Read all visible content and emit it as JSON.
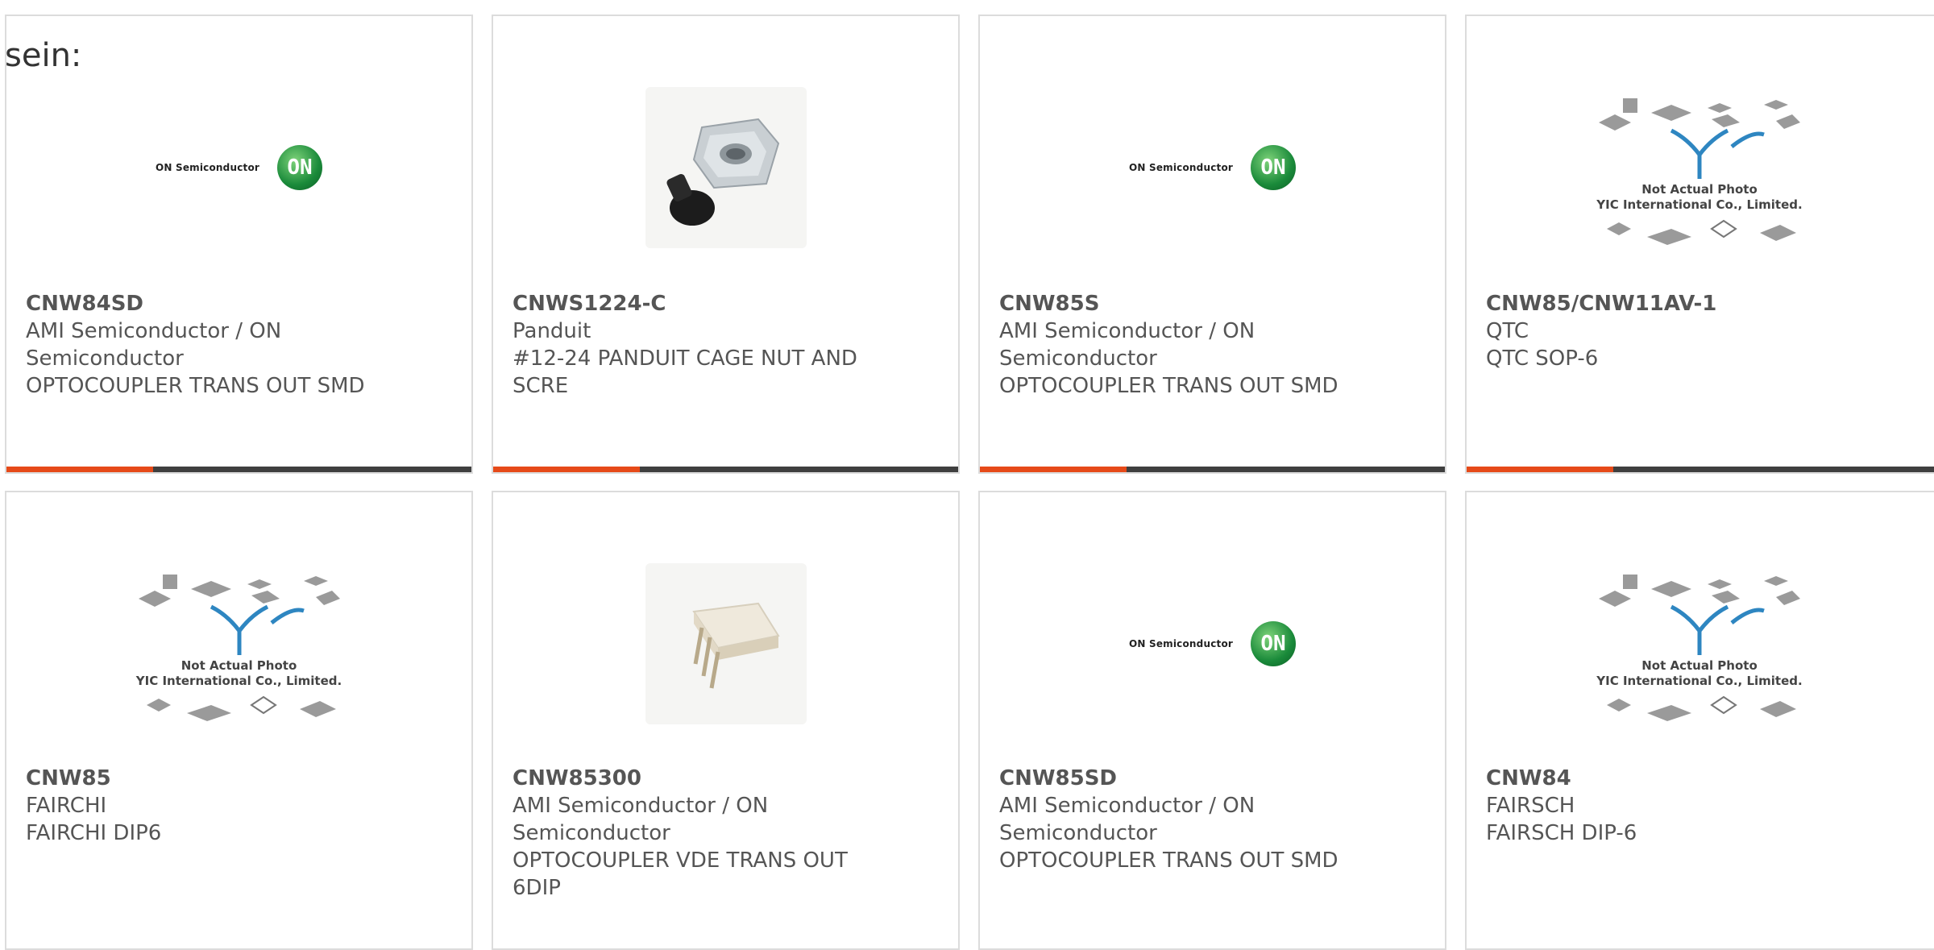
{
  "intro_text": "sein:",
  "icons": {
    "on_logo": "on-semiconductor-logo",
    "yic_logo": "yic-not-actual-photo",
    "cage_nut": "cage-nut-photo",
    "optocoupler": "dip6-optocoupler-photo"
  },
  "colors": {
    "accent": "#e64a19",
    "bar": "#3f3f3f",
    "border": "#dcdcdc"
  },
  "brand_text": {
    "on": "ON Semiconductor",
    "on_circle": "ON",
    "yic_line1": "Not Actual Photo",
    "yic_line2": "YIC International Co., Limited."
  },
  "products": [
    {
      "part": "CNW84SD",
      "maker_l1": "AMI Semiconductor / ON",
      "maker_l2": "Semiconductor",
      "desc_l1": "OPTOCOUPLER TRANS OUT SMD",
      "desc_l2": ""
    },
    {
      "part": "CNWS1224-C",
      "maker_l1": "Panduit",
      "maker_l2": "",
      "desc_l1": "#12-24 PANDUIT CAGE NUT AND",
      "desc_l2": "SCRE"
    },
    {
      "part": "CNW85S",
      "maker_l1": "AMI Semiconductor / ON",
      "maker_l2": "Semiconductor",
      "desc_l1": "OPTOCOUPLER TRANS OUT SMD",
      "desc_l2": ""
    },
    {
      "part": "CNW85/CNW11AV-1",
      "maker_l1": "QTC",
      "maker_l2": "",
      "desc_l1": "QTC SOP-6",
      "desc_l2": ""
    },
    {
      "part": "CNW85",
      "maker_l1": "FAIRCHI",
      "maker_l2": "",
      "desc_l1": "FAIRCHI DIP6",
      "desc_l2": ""
    },
    {
      "part": "CNW85300",
      "maker_l1": "AMI Semiconductor / ON",
      "maker_l2": "Semiconductor",
      "desc_l1": "OPTOCOUPLER VDE TRANS OUT",
      "desc_l2": "6DIP"
    },
    {
      "part": "CNW85SD",
      "maker_l1": "AMI Semiconductor / ON",
      "maker_l2": "Semiconductor",
      "desc_l1": "OPTOCOUPLER TRANS OUT SMD",
      "desc_l2": ""
    },
    {
      "part": "CNW84",
      "maker_l1": "FAIRSCH",
      "maker_l2": "",
      "desc_l1": "FAIRSCH DIP-6",
      "desc_l2": ""
    }
  ]
}
